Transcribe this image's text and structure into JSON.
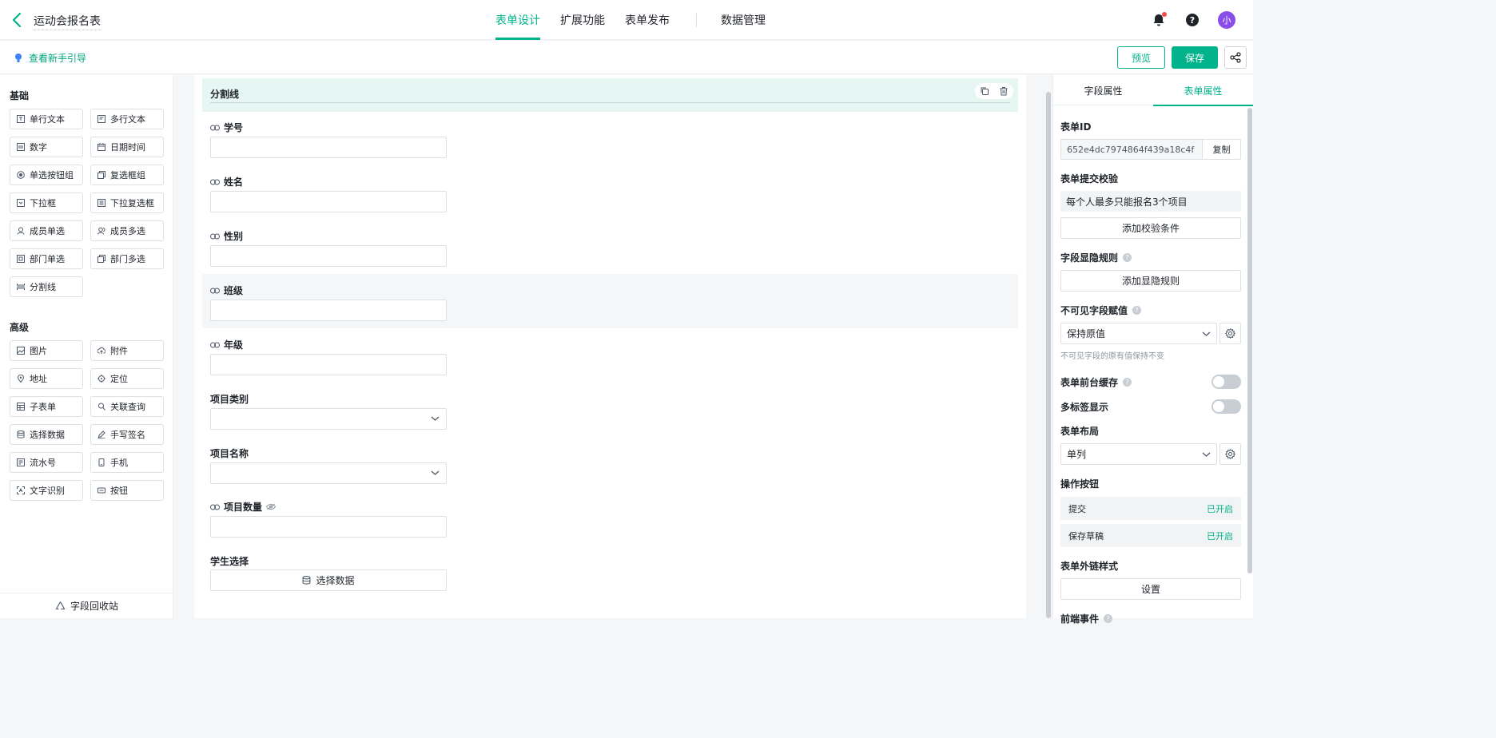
{
  "header": {
    "title": "运动会报名表",
    "tabs": [
      "表单设计",
      "扩展功能",
      "表单发布",
      "数据管理"
    ],
    "avatar_text": "小"
  },
  "subbar": {
    "guide": "查看新手引导",
    "preview": "预览",
    "save": "保存"
  },
  "left": {
    "basic_title": "基础",
    "basic_items": [
      "单行文本",
      "多行文本",
      "数字",
      "日期时间",
      "单选按钮组",
      "复选框组",
      "下拉框",
      "下拉复选框",
      "成员单选",
      "成员多选",
      "部门单选",
      "部门多选",
      "分割线"
    ],
    "advanced_title": "高级",
    "advanced_items": [
      "图片",
      "附件",
      "地址",
      "定位",
      "子表单",
      "关联查询",
      "选择数据",
      "手写签名",
      "流水号",
      "手机",
      "文字识别",
      "按钮"
    ],
    "recycle": "字段回收站"
  },
  "canvas": {
    "divider": "分割线",
    "fields": {
      "student_id": "学号",
      "name": "姓名",
      "gender": "性别",
      "class": "班级",
      "grade": "年级",
      "category": "项目类别",
      "item_name": "项目名称",
      "count": "项目数量",
      "student_select": "学生选择"
    },
    "select_data_btn": "选择数据"
  },
  "right": {
    "tab_field": "字段属性",
    "tab_form": "表单属性",
    "form_id_label": "表单ID",
    "form_id": "652e4dc7974864f439a18c4f",
    "copy": "复制",
    "submit_check_label": "表单提交校验",
    "submit_rule": "每个人最多只能报名3个项目",
    "add_check": "添加校验条件",
    "visibility_label": "字段显隐规则",
    "add_visibility": "添加显隐规则",
    "invisible_label": "不可见字段赋值",
    "invisible_value": "保持原值",
    "invisible_hint": "不可见字段的原有值保持不变",
    "cache_label": "表单前台缓存",
    "multitab_label": "多标签显示",
    "layout_label": "表单布局",
    "layout_value": "单列",
    "ops_label": "操作按钮",
    "ops": [
      {
        "name": "提交",
        "state": "已开启"
      },
      {
        "name": "保存草稿",
        "state": "已开启"
      }
    ],
    "link_style_label": "表单外链样式",
    "settings": "设置",
    "frontend_events_label": "前端事件"
  },
  "colors": {
    "accent": "#00b38a",
    "avatar": "#8a4ee8"
  }
}
